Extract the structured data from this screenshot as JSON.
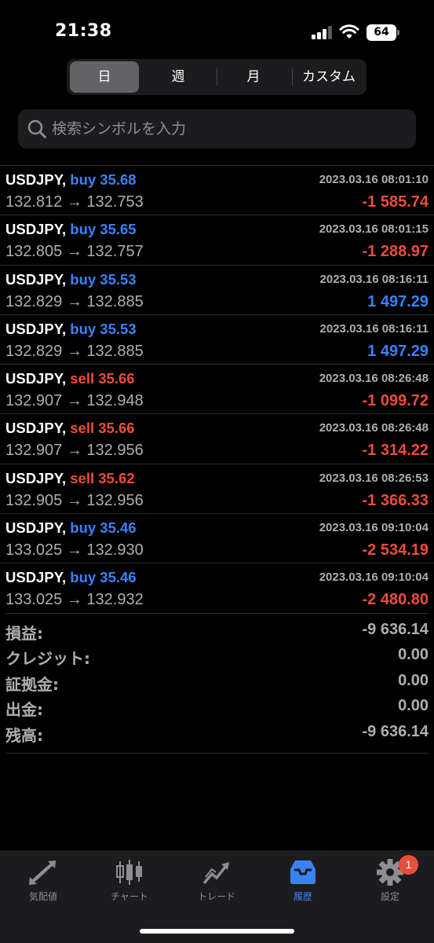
{
  "status_bar": {
    "time": "21:38",
    "battery": "64"
  },
  "segments": [
    {
      "label": "日",
      "active": true
    },
    {
      "label": "週",
      "active": false
    },
    {
      "label": "月",
      "active": false
    },
    {
      "label": "カスタム",
      "active": false
    }
  ],
  "search": {
    "placeholder": "検索シンボルを入力"
  },
  "deals": [
    {
      "symbol": "USDJPY,",
      "side": "buy",
      "volume": "35.68",
      "open": "132.812",
      "arrow": "→",
      "close": "132.753",
      "datetime": "2023.03.16 08:01:10",
      "profit": "-1 585.74"
    },
    {
      "symbol": "USDJPY,",
      "side": "buy",
      "volume": "35.65",
      "open": "132.805",
      "arrow": "→",
      "close": "132.757",
      "datetime": "2023.03.16 08:01:15",
      "profit": "-1 288.97"
    },
    {
      "symbol": "USDJPY,",
      "side": "buy",
      "volume": "35.53",
      "open": "132.829",
      "arrow": "→",
      "close": "132.885",
      "datetime": "2023.03.16 08:16:11",
      "profit": "1 497.29"
    },
    {
      "symbol": "USDJPY,",
      "side": "buy",
      "volume": "35.53",
      "open": "132.829",
      "arrow": "→",
      "close": "132.885",
      "datetime": "2023.03.16 08:16:11",
      "profit": "1 497.29"
    },
    {
      "symbol": "USDJPY,",
      "side": "sell",
      "volume": "35.66",
      "open": "132.907",
      "arrow": "→",
      "close": "132.948",
      "datetime": "2023.03.16 08:26:48",
      "profit": "-1 099.72"
    },
    {
      "symbol": "USDJPY,",
      "side": "sell",
      "volume": "35.66",
      "open": "132.907",
      "arrow": "→",
      "close": "132.956",
      "datetime": "2023.03.16 08:26:48",
      "profit": "-1 314.22"
    },
    {
      "symbol": "USDJPY,",
      "side": "sell",
      "volume": "35.62",
      "open": "132.905",
      "arrow": "→",
      "close": "132.956",
      "datetime": "2023.03.16 08:26:53",
      "profit": "-1 366.33"
    },
    {
      "symbol": "USDJPY,",
      "side": "buy",
      "volume": "35.46",
      "open": "133.025",
      "arrow": "→",
      "close": "132.930",
      "datetime": "2023.03.16 09:10:04",
      "profit": "-2 534.19"
    },
    {
      "symbol": "USDJPY,",
      "side": "buy",
      "volume": "35.46",
      "open": "133.025",
      "arrow": "→",
      "close": "132.932",
      "datetime": "2023.03.16 09:10:04",
      "profit": "-2 480.80"
    }
  ],
  "summary": [
    {
      "label": "損益:",
      "value": "-9 636.14"
    },
    {
      "label": "クレジット:",
      "value": "0.00"
    },
    {
      "label": "証拠金:",
      "value": "0.00"
    },
    {
      "label": "出金:",
      "value": "0.00"
    },
    {
      "label": "残高:",
      "value": "-9 636.14"
    }
  ],
  "tabs": [
    {
      "label": "気配値",
      "icon": "quotes-arrows-icon",
      "active": false
    },
    {
      "label": "チャート",
      "icon": "candlestick-chart-icon",
      "active": false
    },
    {
      "label": "トレード",
      "icon": "trade-chart-icon",
      "active": false
    },
    {
      "label": "履歴",
      "icon": "inbox-history-icon",
      "active": true
    },
    {
      "label": "設定",
      "icon": "gear-icon",
      "active": false,
      "badge": "1"
    }
  ],
  "colors": {
    "buy": "#3a82f7",
    "sell": "#eb4d3d",
    "accent": "#3a82f7"
  }
}
